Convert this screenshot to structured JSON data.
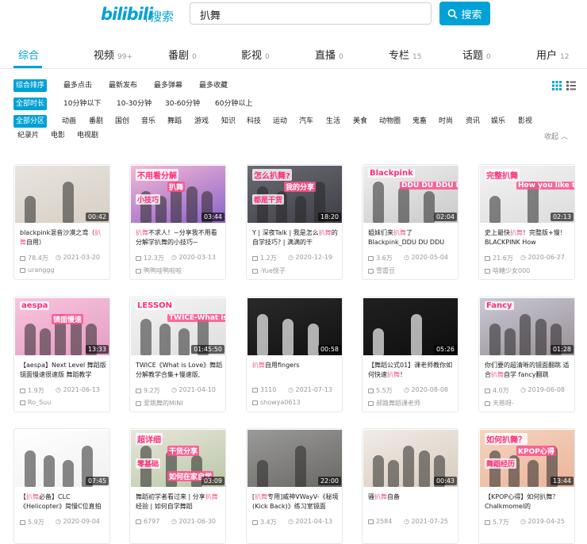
{
  "header": {
    "logo": "bilibili",
    "logo_sub": "搜索",
    "search_value": "扒舞",
    "search_btn": "搜索"
  },
  "tabs": [
    {
      "label": "综合",
      "count": ""
    },
    {
      "label": "视频",
      "count": "99+"
    },
    {
      "label": "番剧",
      "count": "0"
    },
    {
      "label": "影视",
      "count": "0"
    },
    {
      "label": "直播",
      "count": "0"
    },
    {
      "label": "专栏",
      "count": "15"
    },
    {
      "label": "话题",
      "count": "0"
    },
    {
      "label": "用户",
      "count": "12"
    }
  ],
  "sort": [
    "综合排序",
    "最多点击",
    "最新发布",
    "最多弹幕",
    "最多收藏"
  ],
  "duration": [
    "全部时长",
    "10分钟以下",
    "10-30分钟",
    "30-60分钟",
    "60分钟以上"
  ],
  "zones1": [
    "全部分区",
    "动画",
    "番剧",
    "国创",
    "音乐",
    "舞蹈",
    "游戏",
    "知识",
    "科技",
    "运动",
    "汽车",
    "生活",
    "美食",
    "动物圈",
    "鬼畜",
    "时尚",
    "资讯",
    "娱乐",
    "影视"
  ],
  "zones2": [
    "纪录片",
    "电影",
    "电视剧"
  ],
  "collapse": "收起",
  "videos": [
    {
      "dur": "00:42",
      "t1": "blackpink混音沙漠之鸢（",
      "hl": "扒舞",
      "t2": "自用）",
      "views": "78.4万",
      "date": "2021-03-20",
      "up": "uranggg",
      "colors": [
        "#e8e4de",
        "#d6cfc5"
      ]
    },
    {
      "dur": "03:44",
      "hl": "扒舞",
      "t1": "",
      "t2": "不求人！~分享我不用看分解学扒舞的小技巧~",
      "views": "12.3万",
      "date": "2020-03-13",
      "up": "鸭鸭哇鸭啦啦",
      "colors": [
        "#f5b8d4",
        "#8a62c9"
      ],
      "overlay": [
        "不用看分解",
        "扒舞",
        "小技巧"
      ]
    },
    {
      "dur": "18:20",
      "t1": "Y | 深夜Talk | 我是怎么",
      "hl": "扒舞",
      "t2": "的 自学技巧? | 满满的干",
      "views": "1.2万",
      "date": "2020-12-19",
      "up": "-Yue悦子",
      "colors": [
        "#6b6b74",
        "#3e3e46"
      ],
      "overlay": [
        "怎么扒舞?",
        "我的分享",
        "都是干货"
      ]
    },
    {
      "dur": "02:04",
      "t1": "姐妹们来",
      "hl": "扒舞",
      "t2": "了 Blackpink_DDU DU DDU",
      "views": "3.6万",
      "date": "2020-05-04",
      "up": "雪雷豆",
      "colors": [
        "#efefef",
        "#c9c9c9"
      ],
      "overlay": [
        "Blackpink",
        "DDU DU DDU DU"
      ]
    },
    {
      "dur": "02:13",
      "t1": "史上最快",
      "hl": "扒舞",
      "t2": "！完整版+慢！BLACKPINK How",
      "views": "21.6万",
      "date": "2020-06-27",
      "up": "啥糖少女000",
      "colors": [
        "#f3f3f3",
        "#dcdcdc"
      ],
      "overlay": [
        "完整扒舞",
        "How you like that"
      ]
    },
    {
      "dur": "13:33",
      "t1": "【aespa】Next Level 舞蹈版镜面慢速很速版 舞蹈教学",
      "hl": "",
      "t2": "",
      "views": "1.9万",
      "date": "2021-06-13",
      "up": "Ro_Suu",
      "colors": [
        "#f8c4dc",
        "#e59cc4"
      ],
      "overlay": [
        "aespa",
        "镜面慢速"
      ]
    },
    {
      "dur": "01:45:50",
      "t1": "TWICE《What is Love》舞蹈分解教学合集+慢速版,",
      "hl": "",
      "t2": "",
      "views": "9.2万",
      "date": "2021-04-10",
      "up": "爱跳舞的MINI",
      "colors": [
        "#f4f4f4",
        "#dedede"
      ],
      "overlay": [
        "LESSON",
        "TWICE-What is Love?"
      ]
    },
    {
      "dur": "00:58",
      "hl": "扒舞",
      "t1": "",
      "t2": "自用fingers",
      "views": "3110",
      "date": "2021-07-13",
      "up": "showya0613",
      "colors": [
        "#2a2a2a",
        "#111111"
      ]
    },
    {
      "dur": "05:26",
      "t1": "【舞蹈公式01】课老师教你如何快速",
      "hl": "扒舞",
      "t2": "！",
      "views": "5.5万",
      "date": "2020-08-08",
      "up": "郝路舞蹈课老师",
      "colors": [
        "#202020",
        "#0e0e0e"
      ]
    },
    {
      "dur": "01:28",
      "t1": "你们要的超清晰的镜面翻跳 适合",
      "hl": "扒舞",
      "t2": "自学 fancy翻跳",
      "views": "4.0万",
      "date": "2019-06-08",
      "up": "天慈呀-",
      "colors": [
        "#c9c9d6",
        "#9a8f95"
      ],
      "overlay": [
        "Fancy"
      ]
    },
    {
      "dur": "07:45",
      "t1": "【",
      "hl": "扒舞",
      "t2": "必备】CLC《Helicopter》简慢C位直拍",
      "views": "5.9万",
      "date": "2020-09-04",
      "up": "",
      "colors": [
        "#ffffff",
        "#f0f0f0"
      ]
    },
    {
      "dur": "03:09",
      "t1": "舞蹈初学者看过来 | 分享",
      "hl": "扒舞",
      "t2": "经验 | 如何自学舞蹈",
      "views": "6797",
      "date": "2021-06-30",
      "up": "",
      "colors": [
        "#e9e6dc",
        "#b9c7a7"
      ],
      "overlay": [
        "超详细",
        "干货分享",
        "零基础",
        "如何在家自学"
      ]
    },
    {
      "dur": "22:00",
      "t1": "[",
      "hl": "扒舞",
      "t2": "专用]威神VWayV-《秘境 (Kick Back)》练习室镜面",
      "views": "3.4万",
      "date": "2021-04-13",
      "up": "",
      "colors": [
        "#9a9a98",
        "#6a6865"
      ]
    },
    {
      "dur": "00:43",
      "t1": "骚",
      "hl": "扒舞",
      "t2": "自备",
      "views": "2584",
      "date": "2021-07-25",
      "up": "",
      "colors": [
        "#f1ece6",
        "#d8cbbe"
      ]
    },
    {
      "dur": "13:44",
      "t1": "【KPOP心得】如何扒舞？ Chalkmomel的",
      "hl": "",
      "t2": "",
      "views": "5.7万",
      "date": "2019-04-25",
      "up": "",
      "colors": [
        "#f6d4c0",
        "#eab49a"
      ],
      "overlay": [
        "如何扒舞？",
        "KPOP心得",
        "舞蹈经历"
      ]
    }
  ],
  "accent": "#00a1d6",
  "highlight": "#f25d8e"
}
